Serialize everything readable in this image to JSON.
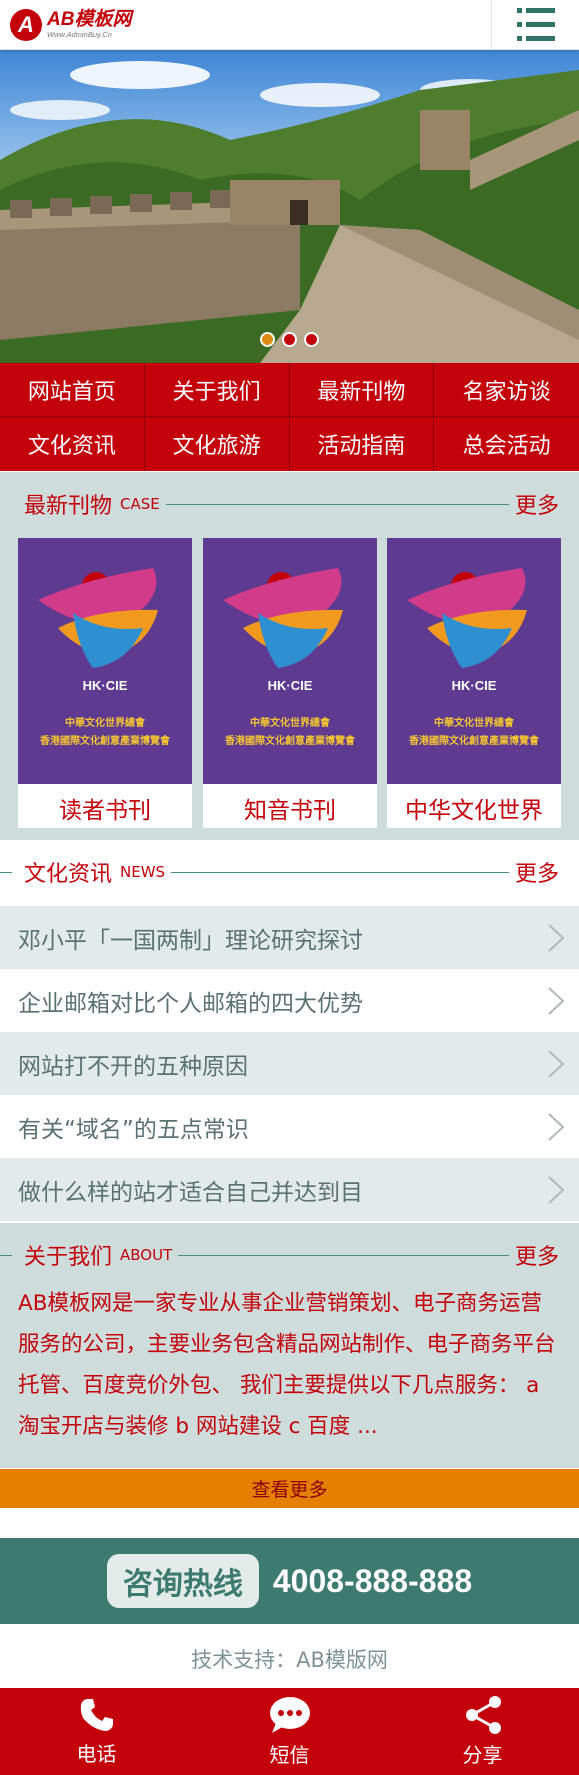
{
  "header": {
    "logo_mark": "A",
    "logo_title": "AB模板网",
    "logo_url": "Www.AdminBuy.Cn",
    "menu_icon": "hamburger-menu-icon"
  },
  "banner": {
    "slide_count": 3,
    "active_slide": 1,
    "image_subject": "great-wall-photo"
  },
  "nav": {
    "items": [
      "网站首页",
      "关于我们",
      "最新刊物",
      "名家访谈",
      "文化资讯",
      "文化旅游",
      "活动指南",
      "总会活动"
    ]
  },
  "products": {
    "title": "最新刊物",
    "title_en": "CASE",
    "more": "更多",
    "cover_badge": "HK·CIE",
    "cover_line1": "中華文化世界總會",
    "cover_line2": "香港國際文化創意產業博覽會",
    "items": [
      {
        "name": "读者书刊"
      },
      {
        "name": "知音书刊"
      },
      {
        "name": "中华文化世界"
      }
    ]
  },
  "news": {
    "title": "文化资讯",
    "title_en": "NEWS",
    "more": "更多",
    "items": [
      "邓小平「一国两制」理论研究探讨",
      "企业邮箱对比个人邮箱的四大优势",
      "网站打不开的五种原因",
      "有关“域名”的五点常识",
      "做什么样的站才适合自己并达到目"
    ]
  },
  "about": {
    "title": "关于我们",
    "title_en": "ABOUT",
    "more": "更多",
    "text": "AB模板网是一家专业从事企业营销策划、电子商务运营服务的公司，主要业务包含精品网站制作、电子商务平台托管、百度竞价外包、 我们主要提供以下几点服务： a 淘宝开店与装修 b 网站建设 c 百度 ...",
    "view_more": "查看更多"
  },
  "hotline": {
    "label": "咨询热线",
    "number": "4008-888-888"
  },
  "support": "技术支持：AB模版网",
  "bottom_bar": {
    "items": [
      {
        "label": "电话",
        "icon": "phone-icon"
      },
      {
        "label": "短信",
        "icon": "message-icon"
      },
      {
        "label": "分享",
        "icon": "share-icon"
      }
    ]
  },
  "colors": {
    "brand_red": "#c4000b",
    "teal": "#3d7a70",
    "section_bg": "#cedcdc",
    "orange": "#e57f00"
  }
}
